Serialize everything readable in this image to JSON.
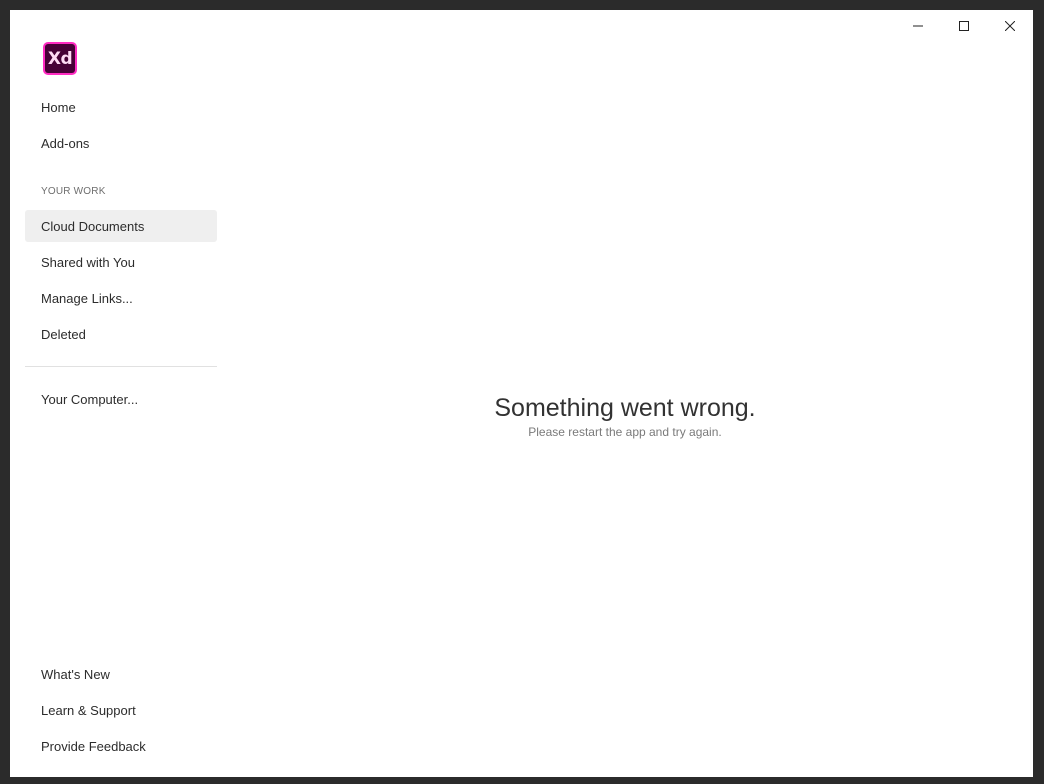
{
  "app": {
    "logo_text": "Xd",
    "brand_colors": {
      "logo_border": "#ff2bc2",
      "logo_bg": "#470137",
      "logo_text": "#ffdbf5"
    }
  },
  "window_controls": {
    "minimize_icon": "minimize-icon",
    "maximize_icon": "maximize-icon",
    "close_icon": "close-icon"
  },
  "sidebar": {
    "top_items": [
      {
        "label": "Home"
      },
      {
        "label": "Add-ons"
      }
    ],
    "section_label": "YOUR WORK",
    "work_items": [
      {
        "label": "Cloud Documents",
        "active": true
      },
      {
        "label": "Shared with You"
      },
      {
        "label": "Manage Links..."
      },
      {
        "label": "Deleted"
      }
    ],
    "computer_item": {
      "label": "Your Computer..."
    },
    "bottom_items": [
      {
        "label": "What's New"
      },
      {
        "label": "Learn & Support"
      },
      {
        "label": "Provide Feedback"
      }
    ]
  },
  "main": {
    "error_title": "Something went wrong.",
    "error_subtitle": "Please restart the app and try again."
  }
}
